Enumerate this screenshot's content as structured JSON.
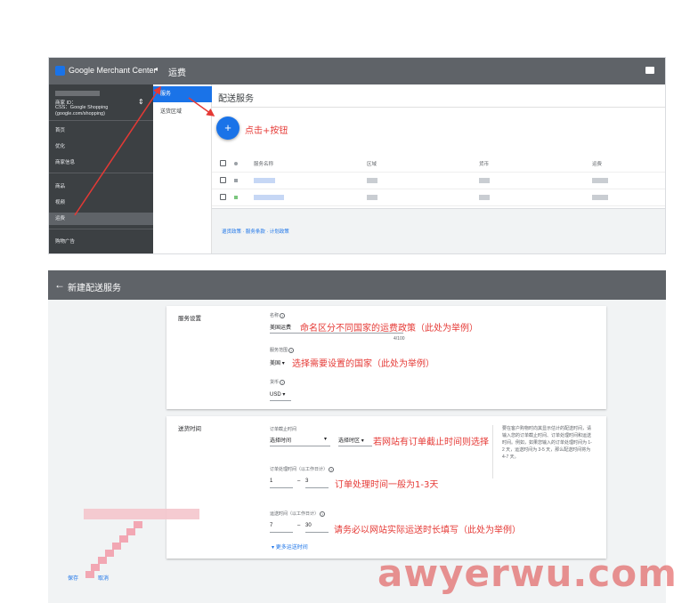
{
  "top_panel": {
    "app_title": "Google Merchant Center",
    "page_title": "运费",
    "account": {
      "id_label": "商家 ID：",
      "css_line1": "CSS：Google Shopping",
      "css_line2": "(google.com/shopping)"
    },
    "nav_items": [
      "首页",
      "优化",
      "商家信息",
      "商品",
      "视频",
      "运费",
      "购物广告"
    ],
    "sub_nav": [
      "服务",
      "送货区域"
    ],
    "section_title": "配送服务",
    "add_button": "+",
    "annotation_click": "点击+按钮",
    "table_headers": [
      "服务名称",
      "区域",
      "货币",
      "运费"
    ],
    "policy_links": "退货政策 · 服务条款 · 计划政策"
  },
  "bottom_panel": {
    "header_title": "新建配送服务",
    "service_settings": {
      "title": "服务设置",
      "name_label": "名称",
      "name_value": "美国运费",
      "name_counter": "4/100",
      "name_annotation": "命名区分不同国家的运费政策（此处为举例）",
      "region_label": "服务范围",
      "region_value": "美国",
      "region_annotation": "选择需要设置的国家（此处为举例）",
      "currency_label": "货币",
      "currency_value": "USD"
    },
    "delivery_time": {
      "title": "送货时间",
      "cutoff_label": "订单截止时间",
      "cutoff_time_value": "选择时间",
      "cutoff_zone_value": "选择时区",
      "cutoff_annotation": "若网站有订单截止时间则选择",
      "handling_label": "订单处理时间（以工作日计）",
      "handling_min": "1",
      "handling_max": "3",
      "handling_annotation": "订单处理时间一般为1-3天",
      "transit_label": "运送时间（以工作日计）",
      "transit_min": "7",
      "transit_max": "30",
      "transit_annotation": "请务必以网站实际运送时长填写（此处为举例）",
      "range_dash": "–",
      "more_link": "更多运送时间",
      "side_note": "要在客户购物时向其显示估计的配送时间，请输入您的订单截止时间、订单处理时间和运送时间。例如，如果您输入的订单处理时间为 1-2 天，运送时间为 3-5 天，那么配送时间将为 4-7 天。"
    },
    "save_label": "保存",
    "cancel_label": "取消"
  },
  "watermark": "awyerwu.com",
  "colors": {
    "accent": "#1a73e8",
    "header_gray": "#5f6368",
    "annotation_red": "#e53935"
  }
}
